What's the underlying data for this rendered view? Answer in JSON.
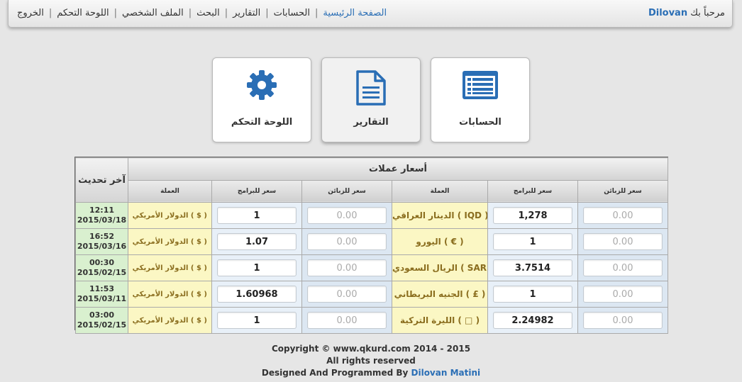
{
  "nav": {
    "welcome_text": "مرحباً بك",
    "user": "Dilovan",
    "menu": [
      "الصفحة الرئيسية",
      "الحسابات",
      "التقارير",
      "البحث",
      "الملف الشخصي",
      "اللوحة التحكم",
      "الخروج"
    ],
    "separator": "|"
  },
  "tiles": [
    {
      "label": "الحسابات",
      "icon": "list-icon"
    },
    {
      "label": "التقارير",
      "icon": "document-icon"
    },
    {
      "label": "اللوحة التحكم",
      "icon": "gear-icon"
    }
  ],
  "rates": {
    "title": "أسعار عملات",
    "last_update_header": "آخر تحديث",
    "col_customer": "سعر للزبائن",
    "col_program": "سعر للبرامج",
    "col_currency": "العملة",
    "rows": [
      {
        "sell_left": "0.00",
        "buy_left": "1,278",
        "currency_left": "الدينار العراقي ( IQD )",
        "sell_right": "0.00",
        "buy_right": "1",
        "currency_right": "الدولار الأمريكي ( $ )",
        "time": "12:11",
        "date": "2015/03/18"
      },
      {
        "sell_left": "0.00",
        "buy_left": "1",
        "currency_left": "اليورو ( € )",
        "sell_right": "0.00",
        "buy_right": "1.07",
        "currency_right": "الدولار الأمريكي ( $ )",
        "time": "16:52",
        "date": "2015/03/16"
      },
      {
        "sell_left": "0.00",
        "buy_left": "3.7514",
        "currency_left": "الريال السعودي ( SAR )",
        "sell_right": "0.00",
        "buy_right": "1",
        "currency_right": "الدولار الأمريكي ( $ )",
        "time": "00:30",
        "date": "2015/02/15"
      },
      {
        "sell_left": "0.00",
        "buy_left": "1",
        "currency_left": "الجنيه البريطاني ( £ )",
        "sell_right": "0.00",
        "buy_right": "1.60968",
        "currency_right": "الدولار الأمريكي ( $ )",
        "time": "11:53",
        "date": "2015/03/11"
      },
      {
        "sell_left": "0.00",
        "buy_left": "2.24982",
        "currency_left": "الليرة التركية ( □ )",
        "sell_right": "0.00",
        "buy_right": "1",
        "currency_right": "الدولار الأمريكي ( $ )",
        "time": "03:00",
        "date": "2015/02/15"
      }
    ]
  },
  "footer": {
    "line1": "Copyright © www.qkurd.com 2014 - 2015",
    "line2": "All rights reserved",
    "line3_prefix": "Designed And Programmed By",
    "author": "Dilovan Matini"
  },
  "colors": {
    "accent": "#2a6eb5",
    "date_bg": "#d9f0cf",
    "currency_bg": "#fbf7c4",
    "input_bg": "#dce7f2"
  }
}
